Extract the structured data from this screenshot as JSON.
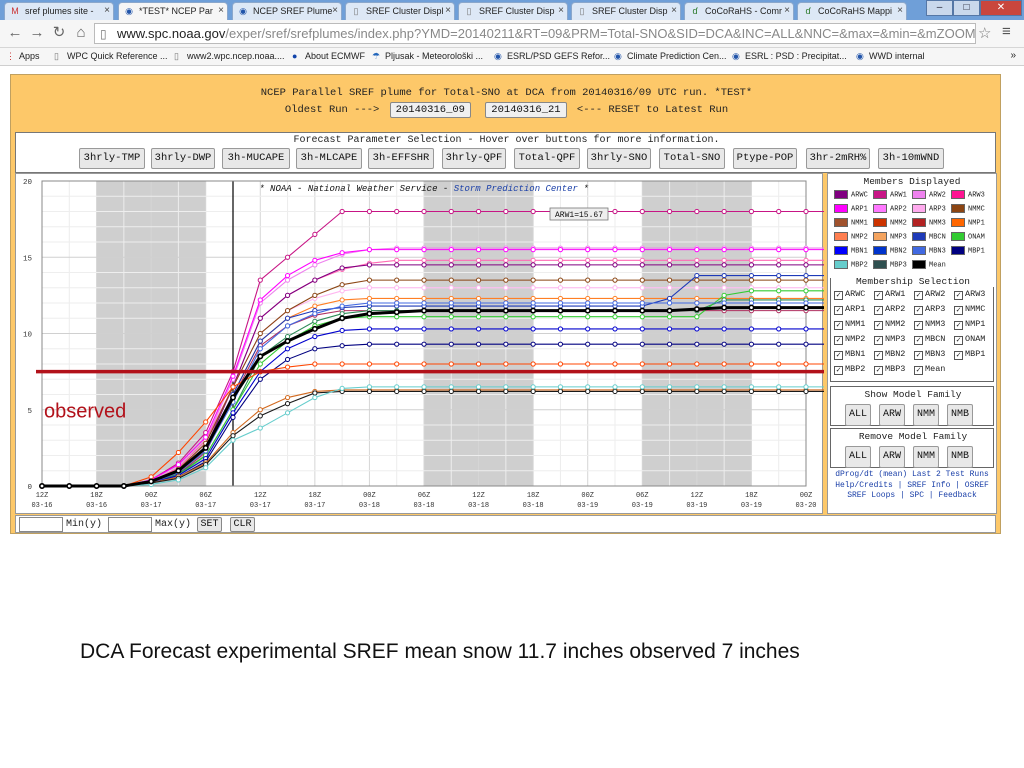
{
  "tabs": [
    {
      "label": "sref plumes site - ",
      "icon": "gmail-icon"
    },
    {
      "label": "*TEST* NCEP Par",
      "icon": "noaa-icon",
      "active": true
    },
    {
      "label": "NCEP SREF Plume",
      "icon": "noaa-icon"
    },
    {
      "label": "SREF Cluster Displ",
      "icon": "page-icon"
    },
    {
      "label": "SREF Cluster Disp",
      "icon": "page-icon"
    },
    {
      "label": "SREF Cluster Disp",
      "icon": "page-icon"
    },
    {
      "label": "CoCoRaHS - Comr",
      "icon": "cocorahs-icon"
    },
    {
      "label": "CoCoRaHS Mappi",
      "icon": "cocorahs-icon"
    }
  ],
  "address": {
    "host": "www.spc.noaa.gov",
    "path": "/exper/sref/srefplumes/index.php?YMD=20140211&RT=09&PRM=Total-SNO&SID=DCA&INC=ALL&NNC=&max=&min=&mZOOM"
  },
  "bookmarks": [
    {
      "label": "Apps",
      "icon": "apps-icon"
    },
    {
      "label": "WPC Quick Reference ...",
      "icon": "page-icon"
    },
    {
      "label": "www2.wpc.ncep.noaa....",
      "icon": "page-icon"
    },
    {
      "label": "About ECMWF",
      "icon": "ecmwf-icon"
    },
    {
      "label": "Pljusak - Meteorološki ...",
      "icon": "pljusak-icon"
    },
    {
      "label": "ESRL/PSD GEFS Refor...",
      "icon": "noaa-icon"
    },
    {
      "label": "Climate Prediction Cen...",
      "icon": "noaa-icon"
    },
    {
      "label": "ESRL : PSD : Precipitat...",
      "icon": "noaa-icon"
    },
    {
      "label": "WWD internal",
      "icon": "noaa-icon"
    }
  ],
  "header": {
    "title": "NCEP Parallel SREF plume for Total-SNO at DCA from 20140316/09 UTC run. *TEST*",
    "oldest_label": "Oldest Run --->",
    "run_buttons": [
      "20140316_09",
      "20140316_21"
    ],
    "reset_label": "<--- RESET to Latest Run"
  },
  "params": {
    "title": "Forecast Parameter Selection - Hover over buttons for more information.",
    "buttons": [
      "3hrly-TMP",
      "3hrly-DWP",
      "3h-MUCAPE",
      "3h-MLCAPE",
      "3h-EFFSHR",
      "3hrly-QPF",
      "Total-QPF",
      "3hrly-SNO",
      "Total-SNO",
      "Ptype-POP",
      "3hr-2mRH%",
      "3h-10mWND"
    ]
  },
  "chart_data": {
    "type": "line",
    "title": "* NOAA - National Weather Service - Storm Prediction Center *",
    "title_plain": "* NOAA - National Weather Service -",
    "title_link": "Storm Prediction Center",
    "title_end": "*",
    "tooltip": "ARW1=15.67",
    "observed_label": "observed",
    "observed_value": 7.5,
    "ylim": [
      0,
      20
    ],
    "yticks": [
      "0",
      "5",
      "10",
      "15",
      "20"
    ],
    "xticks": [
      {
        "time": "12Z",
        "date": "03-16"
      },
      {
        "time": "18Z",
        "date": "03-16"
      },
      {
        "time": "00Z",
        "date": "03-17"
      },
      {
        "time": "06Z",
        "date": "03-17"
      },
      {
        "time": "12Z",
        "date": "03-17"
      },
      {
        "time": "18Z",
        "date": "03-17"
      },
      {
        "time": "00Z",
        "date": "03-18"
      },
      {
        "time": "06Z",
        "date": "03-18"
      },
      {
        "time": "12Z",
        "date": "03-18"
      },
      {
        "time": "18Z",
        "date": "03-18"
      },
      {
        "time": "00Z",
        "date": "03-19"
      },
      {
        "time": "06Z",
        "date": "03-19"
      },
      {
        "time": "12Z",
        "date": "03-19"
      },
      {
        "time": "18Z",
        "date": "03-19"
      },
      {
        "time": "00Z",
        "date": "03-20"
      }
    ],
    "x_hours": [
      0,
      3,
      6,
      9,
      12,
      15,
      18,
      21,
      24,
      27,
      30,
      33,
      36,
      39,
      42,
      45,
      48,
      51,
      54,
      57,
      60,
      63,
      66,
      69,
      72,
      75,
      78,
      81,
      84,
      87
    ],
    "shaded_hours": [
      [
        6,
        18
      ],
      [
        42,
        54
      ],
      [
        66,
        78
      ]
    ],
    "current_hour": 21,
    "series": [
      {
        "name": "ARW1",
        "color": "#c71585",
        "final": 18.0,
        "values": [
          0,
          0,
          0,
          0,
          0.4,
          1.5,
          3.5,
          7.5,
          13.5,
          15.0,
          16.5,
          18.0,
          18.0,
          18.0,
          18.0,
          18.0,
          18.0,
          18.0,
          18.0,
          18.0,
          18.0,
          18.0,
          18.0,
          18.0,
          18.0,
          18.0,
          18.0,
          18.0,
          18.0,
          18.0
        ]
      },
      {
        "name": "ARW2",
        "color": "#ee82ee",
        "final": 15.6,
        "values": [
          0,
          0,
          0,
          0,
          0.3,
          1.2,
          3.0,
          7.0,
          12.0,
          13.5,
          14.5,
          15.2,
          15.5,
          15.6,
          15.6,
          15.6,
          15.6,
          15.6,
          15.6,
          15.6,
          15.6,
          15.6,
          15.6,
          15.6,
          15.6,
          15.6,
          15.6,
          15.6,
          15.6,
          15.6
        ]
      },
      {
        "name": "ARW3",
        "color": "#ff69b4",
        "final": 14.8,
        "values": [
          0,
          0,
          0,
          0,
          0.3,
          1.2,
          3.0,
          6.5,
          11.0,
          12.5,
          13.5,
          14.2,
          14.6,
          14.8,
          14.8,
          14.8,
          14.8,
          14.8,
          14.8,
          14.8,
          14.8,
          14.8,
          14.8,
          14.8,
          14.8,
          14.8,
          14.8,
          14.8,
          14.8,
          14.8
        ]
      },
      {
        "name": "ARWC",
        "color": "#800080",
        "final": 14.5,
        "values": [
          0,
          0,
          0,
          0,
          0.3,
          1.0,
          2.5,
          6.5,
          11.0,
          12.5,
          13.5,
          14.3,
          14.5,
          14.5,
          14.5,
          14.5,
          14.5,
          14.5,
          14.5,
          14.5,
          14.5,
          14.5,
          14.5,
          14.5,
          14.5,
          14.5,
          14.5,
          14.5,
          14.5,
          14.5
        ]
      },
      {
        "name": "ARP1",
        "color": "#ff00ff",
        "final": 15.5,
        "values": [
          0,
          0,
          0,
          0,
          0.4,
          1.4,
          3.2,
          7.2,
          12.2,
          13.8,
          14.8,
          15.3,
          15.5,
          15.5,
          15.5,
          15.5,
          15.5,
          15.5,
          15.5,
          15.5,
          15.5,
          15.5,
          15.5,
          15.5,
          15.5,
          15.5,
          15.5,
          15.5,
          15.5,
          15.5
        ]
      },
      {
        "name": "ARP2",
        "color": "#ffb6f0",
        "final": 13.0,
        "values": [
          0,
          0,
          0,
          0,
          0.3,
          1.0,
          2.8,
          6.5,
          10.0,
          11.5,
          12.3,
          12.8,
          13.0,
          13.0,
          13.0,
          13.0,
          13.0,
          13.0,
          13.0,
          13.0,
          13.0,
          13.0,
          13.0,
          13.0,
          13.0,
          13.0,
          13.0,
          13.0,
          13.0,
          13.0
        ]
      },
      {
        "name": "NMMC",
        "color": "#8b4513",
        "final": 13.5,
        "values": [
          0,
          0,
          0,
          0,
          0.3,
          1.1,
          2.8,
          6.5,
          10.0,
          11.5,
          12.5,
          13.2,
          13.5,
          13.5,
          13.5,
          13.5,
          13.5,
          13.5,
          13.5,
          13.5,
          13.5,
          13.5,
          13.5,
          13.5,
          13.5,
          13.5,
          13.5,
          13.5,
          13.5,
          13.5
        ]
      },
      {
        "name": "NMB1",
        "color": "#ff7f24",
        "final": 12.3,
        "values": [
          0,
          0,
          0,
          0,
          0.3,
          1.0,
          2.5,
          6.0,
          9.5,
          11.0,
          11.8,
          12.2,
          12.3,
          12.3,
          12.3,
          12.3,
          12.3,
          12.3,
          12.3,
          12.3,
          12.3,
          12.3,
          12.3,
          12.3,
          12.3,
          12.3,
          12.3,
          12.3,
          12.3,
          12.3
        ]
      },
      {
        "name": "NMM1",
        "color": "#b03060",
        "final": 11.5,
        "values": [
          0,
          0,
          0,
          0,
          0.2,
          0.8,
          2.2,
          5.8,
          9.2,
          10.5,
          11.2,
          11.5,
          11.5,
          11.5,
          11.5,
          11.5,
          11.5,
          11.5,
          11.5,
          11.5,
          11.5,
          11.5,
          11.5,
          11.5,
          11.5,
          11.5,
          11.5,
          11.5,
          11.5,
          11.5
        ]
      },
      {
        "name": "MBCN",
        "color": "#1e3ab8",
        "final": 13.8,
        "values": [
          0,
          0,
          0,
          0,
          0.3,
          1.0,
          2.5,
          6.0,
          9.5,
          11.0,
          11.5,
          11.7,
          11.8,
          11.8,
          11.8,
          11.8,
          11.8,
          11.8,
          11.8,
          11.8,
          11.8,
          11.8,
          11.8,
          12.3,
          13.8,
          13.8,
          13.8,
          13.8,
          13.8,
          13.8
        ]
      },
      {
        "name": "NMM3",
        "color": "#2e8b57",
        "final": 12.2,
        "values": [
          0,
          0,
          0,
          0,
          0.2,
          0.8,
          2.0,
          5.0,
          8.5,
          9.8,
          10.8,
          11.3,
          11.5,
          11.5,
          11.5,
          11.5,
          11.5,
          11.5,
          11.5,
          11.5,
          11.5,
          11.5,
          11.5,
          11.5,
          11.5,
          12.2,
          12.2,
          12.2,
          12.2,
          12.2
        ]
      },
      {
        "name": "ONAM",
        "color": "#33cc33",
        "final": 11.1,
        "values": [
          0,
          0,
          0,
          0,
          0.2,
          0.7,
          2.0,
          5.0,
          8.0,
          9.5,
          10.5,
          11.0,
          11.1,
          11.1,
          11.1,
          11.1,
          11.1,
          11.1,
          11.1,
          11.1,
          11.1,
          11.1,
          11.1,
          11.1,
          11.1,
          12.5,
          12.8,
          12.8,
          12.8,
          12.8
        ]
      },
      {
        "name": "MBN1",
        "color": "#0000cd",
        "final": 10.3,
        "values": [
          0,
          0,
          0,
          0,
          0.2,
          0.7,
          1.8,
          4.8,
          7.5,
          9.0,
          9.8,
          10.2,
          10.3,
          10.3,
          10.3,
          10.3,
          10.3,
          10.3,
          10.3,
          10.3,
          10.3,
          10.3,
          10.3,
          10.3,
          10.3,
          10.3,
          10.3,
          10.3,
          10.3,
          10.3
        ]
      },
      {
        "name": "MBN3",
        "color": "#4169e1",
        "final": 12.0,
        "values": [
          0,
          0,
          0,
          0,
          0.2,
          0.9,
          2.3,
          5.5,
          9.0,
          10.5,
          11.3,
          11.8,
          12.0,
          12.0,
          12.0,
          12.0,
          12.0,
          12.0,
          12.0,
          12.0,
          12.0,
          12.0,
          12.0,
          12.0,
          12.0,
          12.0,
          12.0,
          12.0,
          12.0,
          12.0
        ]
      },
      {
        "name": "MBN2",
        "color": "#000080",
        "final": 9.3,
        "values": [
          0,
          0,
          0,
          0,
          0.2,
          0.6,
          1.6,
          4.5,
          7.0,
          8.3,
          9.0,
          9.2,
          9.3,
          9.3,
          9.3,
          9.3,
          9.3,
          9.3,
          9.3,
          9.3,
          9.3,
          9.3,
          9.3,
          9.3,
          9.3,
          9.3,
          9.3,
          9.3,
          9.3,
          9.3
        ]
      },
      {
        "name": "NMP1",
        "color": "#ff4500",
        "final": 8.0,
        "values": [
          0,
          0,
          0,
          0,
          0.6,
          2.2,
          4.2,
          6.5,
          7.5,
          7.8,
          8.0,
          8.0,
          8.0,
          8.0,
          8.0,
          8.0,
          8.0,
          8.0,
          8.0,
          8.0,
          8.0,
          8.0,
          8.0,
          8.0,
          8.0,
          8.0,
          8.0,
          8.0,
          8.0,
          8.0
        ]
      },
      {
        "name": "NMM2",
        "color": "#d2691e",
        "final": 6.3,
        "values": [
          0,
          0,
          0,
          0,
          0.2,
          0.6,
          1.5,
          3.5,
          5.0,
          5.8,
          6.2,
          6.3,
          6.3,
          6.3,
          6.3,
          6.3,
          6.3,
          6.3,
          6.3,
          6.3,
          6.3,
          6.3,
          6.3,
          6.3,
          6.3,
          6.3,
          6.3,
          6.3,
          6.3,
          6.3
        ]
      },
      {
        "name": "NMB3",
        "color": "#1a1a1a",
        "final": 6.2,
        "values": [
          0,
          0,
          0,
          0,
          0.2,
          0.5,
          1.4,
          3.3,
          4.6,
          5.4,
          6.1,
          6.2,
          6.2,
          6.2,
          6.2,
          6.2,
          6.2,
          6.2,
          6.2,
          6.2,
          6.2,
          6.2,
          6.2,
          6.2,
          6.2,
          6.2,
          6.2,
          6.2,
          6.2,
          6.2
        ]
      },
      {
        "name": "MBP2",
        "color": "#66cdcc",
        "final": 6.5,
        "values": [
          0,
          0,
          0,
          0,
          0.1,
          0.4,
          1.2,
          3.0,
          3.8,
          4.8,
          5.8,
          6.4,
          6.5,
          6.5,
          6.5,
          6.5,
          6.5,
          6.5,
          6.5,
          6.5,
          6.5,
          6.5,
          6.5,
          6.5,
          6.5,
          6.5,
          6.5,
          6.5,
          6.5,
          6.5
        ]
      },
      {
        "name": "Mean",
        "color": "#000000",
        "bold": true,
        "final": 11.7,
        "values": [
          0,
          0,
          0,
          0,
          0.3,
          1.0,
          2.5,
          5.8,
          8.5,
          9.5,
          10.3,
          11.0,
          11.3,
          11.4,
          11.5,
          11.5,
          11.5,
          11.5,
          11.5,
          11.5,
          11.5,
          11.5,
          11.5,
          11.5,
          11.6,
          11.7,
          11.7,
          11.7,
          11.7,
          11.7
        ]
      }
    ]
  },
  "legend": {
    "members_title": "Members Displayed",
    "members": [
      {
        "label": "ARWC",
        "color": "#800080"
      },
      {
        "label": "ARW1",
        "color": "#c71585"
      },
      {
        "label": "ARW2",
        "color": "#ee82ee"
      },
      {
        "label": "ARW3",
        "color": "#ff1493"
      },
      {
        "label": "ARP1",
        "color": "#ff00ff"
      },
      {
        "label": "ARP2",
        "color": "#ff77ff"
      },
      {
        "label": "ARP3",
        "color": "#ffaaee"
      },
      {
        "label": "NMMC",
        "color": "#8b4513"
      },
      {
        "label": "NMM1",
        "color": "#a0522d"
      },
      {
        "label": "NMM2",
        "color": "#cc3300"
      },
      {
        "label": "NMM3",
        "color": "#b22222"
      },
      {
        "label": "NMP1",
        "color": "#ff6600"
      },
      {
        "label": "NMP2",
        "color": "#ff7f50"
      },
      {
        "label": "NMP3",
        "color": "#f4a460"
      },
      {
        "label": "MBCN",
        "color": "#1e3ab8"
      },
      {
        "label": "ONAM",
        "color": "#33cc33"
      },
      {
        "label": "MBN1",
        "color": "#0000ff"
      },
      {
        "label": "MBN2",
        "color": "#0033cc"
      },
      {
        "label": "MBN3",
        "color": "#4169e1"
      },
      {
        "label": "MBP1",
        "color": "#000080"
      },
      {
        "label": "MBP2",
        "color": "#66cdcc"
      },
      {
        "label": "MBP3",
        "color": "#2f4f4f"
      },
      {
        "label": "Mean",
        "color": "#000000"
      }
    ],
    "membership_title": "Membership Selection",
    "membership": [
      "ARWC",
      "ARW1",
      "ARW2",
      "ARW3",
      "ARP1",
      "ARP2",
      "ARP3",
      "NMMC",
      "NMM1",
      "NMM2",
      "NMM3",
      "NMP1",
      "NMP2",
      "NMP3",
      "MBCN",
      "ONAM",
      "MBN1",
      "MBN2",
      "MBN3",
      "MBP1",
      "MBP2",
      "MBP3",
      "Mean"
    ],
    "show_title": "Show Model Family",
    "remove_title": "Remove Model Family",
    "family_buttons": [
      "ALL",
      "ARW",
      "NMM",
      "NMB"
    ],
    "links": [
      "dProg/dt (mean) Last 2 Test Runs",
      "Help/Credits | SREF Info | OSREF",
      "SREF Loops | SPC | Feedback"
    ]
  },
  "minmax": {
    "min_label": "Min(y)",
    "max_label": "Max(y)",
    "set_label": "SET",
    "clr_label": "CLR"
  },
  "caption": "DCA Forecast experimental SREF mean snow 11.7 inches observed 7 inches"
}
